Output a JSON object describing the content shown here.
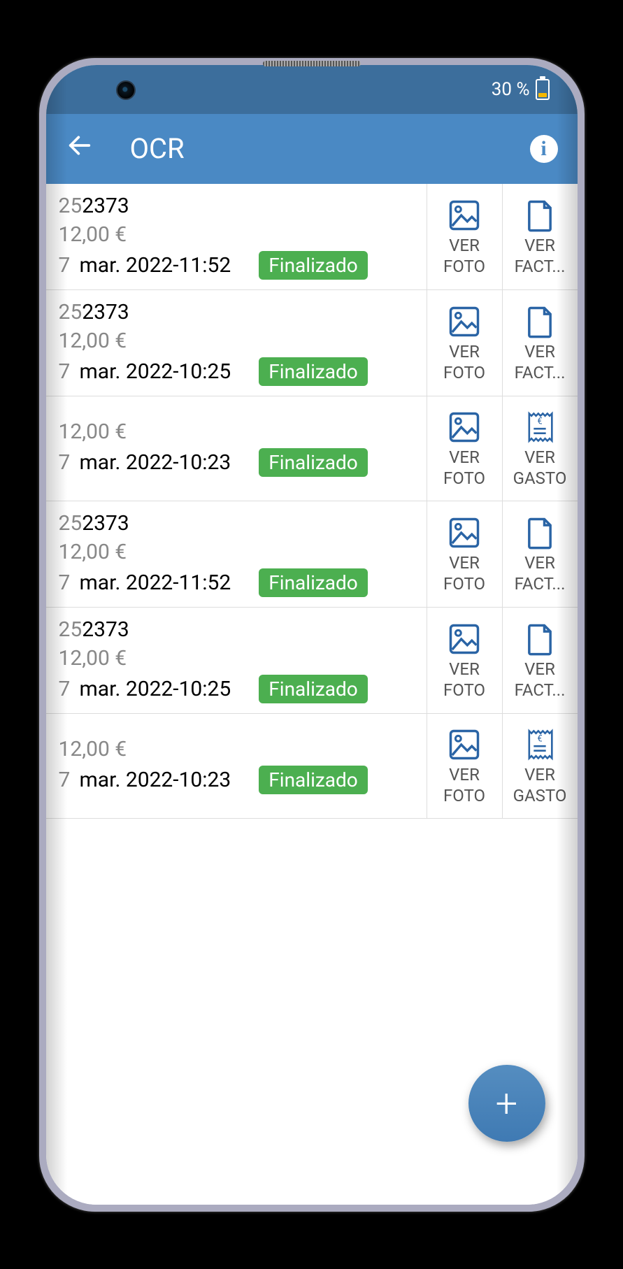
{
  "status": {
    "battery_pct": "30 %"
  },
  "appbar": {
    "title": "OCR"
  },
  "labels": {
    "ver": "VER",
    "foto": "FOTO",
    "fact": "FACT...",
    "gasto": "GASTO"
  },
  "fab": {
    "plus": "+"
  },
  "rows": [
    {
      "id_faded": "25",
      "id_bold": "2373",
      "amount": "12,00 €",
      "date": "7 mar. 2022-11:52",
      "status": "Finalizado",
      "second_action": "fact"
    },
    {
      "id_faded": "25",
      "id_bold": "2373",
      "amount": "12,00 €",
      "date": "7 mar. 2022-10:25",
      "status": "Finalizado",
      "second_action": "fact"
    },
    {
      "id_faded": "",
      "id_bold": "",
      "amount": "12,00 €",
      "date": "7 mar. 2022-10:23",
      "status": "Finalizado",
      "second_action": "gasto"
    },
    {
      "id_faded": "25",
      "id_bold": "2373",
      "amount": "12,00 €",
      "date": "7 mar. 2022-11:52",
      "status": "Finalizado",
      "second_action": "fact"
    },
    {
      "id_faded": "25",
      "id_bold": "2373",
      "amount": "12,00 €",
      "date": "7 mar. 2022-10:25",
      "status": "Finalizado",
      "second_action": "fact"
    },
    {
      "id_faded": "",
      "id_bold": "",
      "amount": "12,00 €",
      "date": "7 mar. 2022-10:23",
      "status": "Finalizado",
      "second_action": "gasto"
    }
  ]
}
